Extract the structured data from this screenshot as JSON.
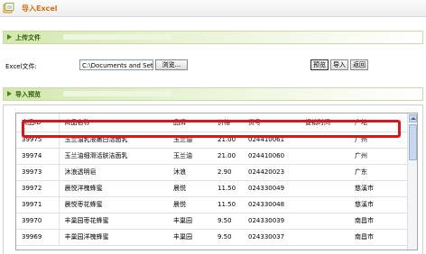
{
  "window": {
    "title": "导入Excel"
  },
  "upload_section": {
    "title": "上传文件"
  },
  "upload_form": {
    "file_label": "Excel文件:",
    "file_value": "C:\\Documents and Sett",
    "browse_label": "浏览...",
    "preview_label": "预览",
    "import_label": "导入",
    "back_label": "返回"
  },
  "preview_section": {
    "title": "导入预览"
  },
  "table": {
    "columns": [
      "商品ID",
      "商品名称",
      "品牌",
      "价格",
      "货号",
      "促销时间",
      "产地"
    ],
    "rows": [
      [
        "39975",
        "玉兰油乳液嫩白活面乳",
        "玉兰油",
        "21.00",
        "024410061",
        "",
        "广州"
      ],
      [
        "39974",
        "玉兰油细滑活肤洁面乳",
        "玉兰油",
        "21.00",
        "024410060",
        "",
        "广州"
      ],
      [
        "39973",
        "沐浪透明皂",
        "沐浪",
        "2.90",
        "024420023",
        "",
        "广东"
      ],
      [
        "39972",
        "晨悦洋槐蜂蜜",
        "晨悦",
        "11.50",
        "024330049",
        "",
        "慈溪市"
      ],
      [
        "39971",
        "晨悦枣花蜂蜜",
        "晨悦",
        "11.50",
        "024330048",
        "",
        "慈溪市"
      ],
      [
        "39970",
        "丰巢园枣花蜂蜜",
        "丰巢园",
        "9.50",
        "024330039",
        "",
        "南昌市"
      ],
      [
        "39969",
        "丰巢园洋槐蜂蜜",
        "丰巢园",
        "9.50",
        "024330037",
        "",
        "南昌市"
      ]
    ]
  },
  "colors": {
    "title_orange": "#d9700c",
    "section_green": "#2d5e0b",
    "highlight_red": "#e0131c"
  },
  "icons": {
    "title": "excel-import-icon",
    "section": "arrow-right-icon"
  }
}
